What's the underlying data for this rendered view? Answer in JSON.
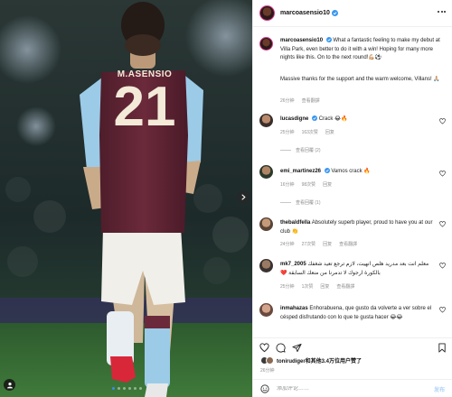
{
  "post": {
    "author": "marcoasensio10",
    "jersey_name": "M.ASENSIO",
    "jersey_number": "21",
    "carousel": {
      "total": 6,
      "active_index": 0
    }
  },
  "caption": {
    "author": "marcoasensio10",
    "text": "What a fantastic feeling to make my debut at Villa Park, even better to do it with a win! Hoping for many more nights like this. On to the next round!💪🏼⚽",
    "text2": "Massive thanks for the support and the warm welcome, Villans! 🙏🏼",
    "time": "26分钟",
    "translate": "查看翻譯"
  },
  "comments": [
    {
      "user": "lucasdigne",
      "verified": true,
      "text": "Crack 😂🔥",
      "time": "25分钟",
      "likes": "163次赞",
      "reply": "回复",
      "view_replies": "查看回覆 (2)"
    },
    {
      "user": "emi_martinez26",
      "verified": true,
      "text": "Vamos crack 🔥",
      "time": "16分钟",
      "likes": "98次赞",
      "reply": "回复",
      "view_replies": "查看回覆 (1)"
    },
    {
      "user": "thebaldfella",
      "verified": false,
      "text": "Absolutely superb player, proud to have you at our club 👏",
      "time": "24分钟",
      "likes": "27次赞",
      "reply": "回复",
      "translate": "查看翻譯"
    },
    {
      "user": "mk7_2005",
      "verified": false,
      "text": "معلم انت بعد مدريد هلص انهيت، لازم ترجع تعيد شغفك بالكورة ارجوك لا تدمرنا من منعك السابقة ❤️",
      "time": "25分钟",
      "likes": "1次赞",
      "reply": "回复",
      "translate": "查看翻譯"
    },
    {
      "user": "inmahazas",
      "verified": false,
      "text": "Enhorabuena, que gusto da volverte a ver sobre el césped disfrutando con lo que te gusta hacer 😂😂"
    }
  ],
  "likes_summary": {
    "text": "tonirudiger和其他3.4万位用户赞了",
    "time": "26分钟"
  },
  "comment_input": {
    "placeholder": "添加评论……",
    "post_label": "发布"
  },
  "colors": {
    "verified": "#3897f0",
    "heart": "#262626",
    "post_button_disabled": "#b3d3f6",
    "shirt_claret": "#6b2a3b",
    "shirt_sleeve": "#9ccbe8"
  }
}
